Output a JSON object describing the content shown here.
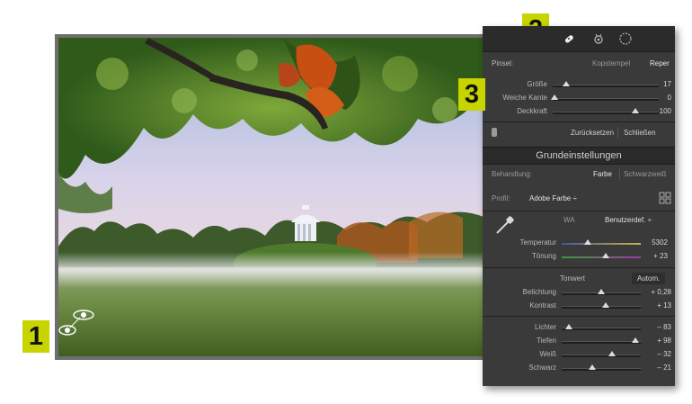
{
  "badges": {
    "one": "1",
    "two": "2",
    "three": "3"
  },
  "brush": {
    "section_label": "Pinsel:",
    "mode_clone": "Kopstempel",
    "mode_repair": "Reper",
    "size_label": "Größe",
    "size_value": "17",
    "size_level": 0.18,
    "feather_label": "Weiche Kante",
    "feather_value": "0",
    "feather_level": 0.0,
    "opacity_label": "Deckkraft",
    "opacity_value": "100",
    "opacity_level": 1.0,
    "reset_label": "Zurücksetzen",
    "close_label": "Schließen"
  },
  "basic": {
    "title": "Grundeinstellungen",
    "treatment_label": "Behandlung:",
    "treatment_color": "Farbe",
    "treatment_bw": "Schwarzweiß",
    "profile_label": "Profil:",
    "profile_value": "Adobe Farbe ÷",
    "wb_label": "WA",
    "wb_value": "Benutzerdef. ÷",
    "temp_label": "Temperatur",
    "temp_value": "5302",
    "tint_label": "Tönung",
    "tint_value": "+ 23",
    "tone_label": "Tonwert",
    "auto_label": "Autom.",
    "exposure_label": "Belichtung",
    "exposure_value": "+ 0,28",
    "contrast_label": "Kontrast",
    "contrast_value": "+ 13",
    "highlights_label": "Lichter",
    "highlights_value": "– 83",
    "shadows_label": "Tiefen",
    "shadows_value": "+ 98",
    "whites_label": "Weiß",
    "whites_value": "– 32",
    "blacks_label": "Schwarz",
    "blacks_value": "– 21"
  },
  "colors": {
    "badge": "#c8d400",
    "panel": "#3a3a3a",
    "panel_dark": "#2a2a2a"
  }
}
